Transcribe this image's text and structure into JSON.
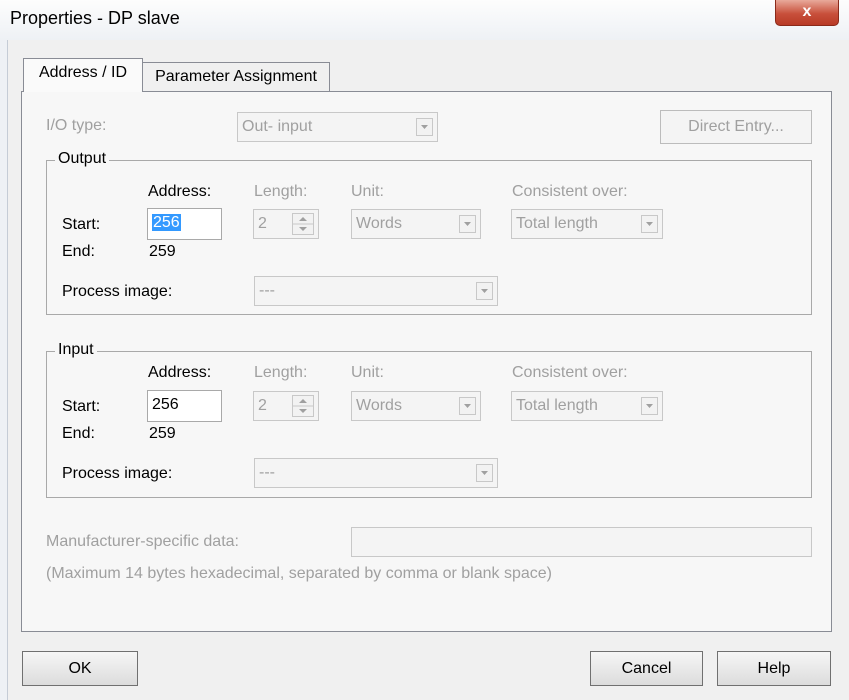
{
  "window": {
    "title": "Properties - DP slave",
    "close_label": "x"
  },
  "tabs": [
    {
      "label": "Address / ID",
      "active": true
    },
    {
      "label": "Parameter Assignment",
      "active": false
    }
  ],
  "io_type": {
    "label": "I/O type:",
    "value": "Out- input"
  },
  "direct_entry_label": "Direct Entry...",
  "column_labels": {
    "address": "Address:",
    "length": "Length:",
    "unit": "Unit:",
    "consistent": "Consistent over:"
  },
  "output": {
    "title": "Output",
    "start_label": "Start:",
    "start_value": "256",
    "end_label": "End:",
    "end_value": "259",
    "length": "2",
    "unit": "Words",
    "consistent": "Total length",
    "process_image_label": "Process image:",
    "process_image_value": "---"
  },
  "input": {
    "title": "Input",
    "start_label": "Start:",
    "start_value": "256",
    "end_label": "End:",
    "end_value": "259",
    "length": "2",
    "unit": "Words",
    "consistent": "Total length",
    "process_image_label": "Process image:",
    "process_image_value": "---"
  },
  "manufacturer": {
    "label": "Manufacturer-specific data:",
    "value": "",
    "hint": "(Maximum 14 bytes hexadecimal, separated by comma or blank space)"
  },
  "buttons": {
    "ok": "OK",
    "cancel": "Cancel",
    "help": "Help"
  }
}
